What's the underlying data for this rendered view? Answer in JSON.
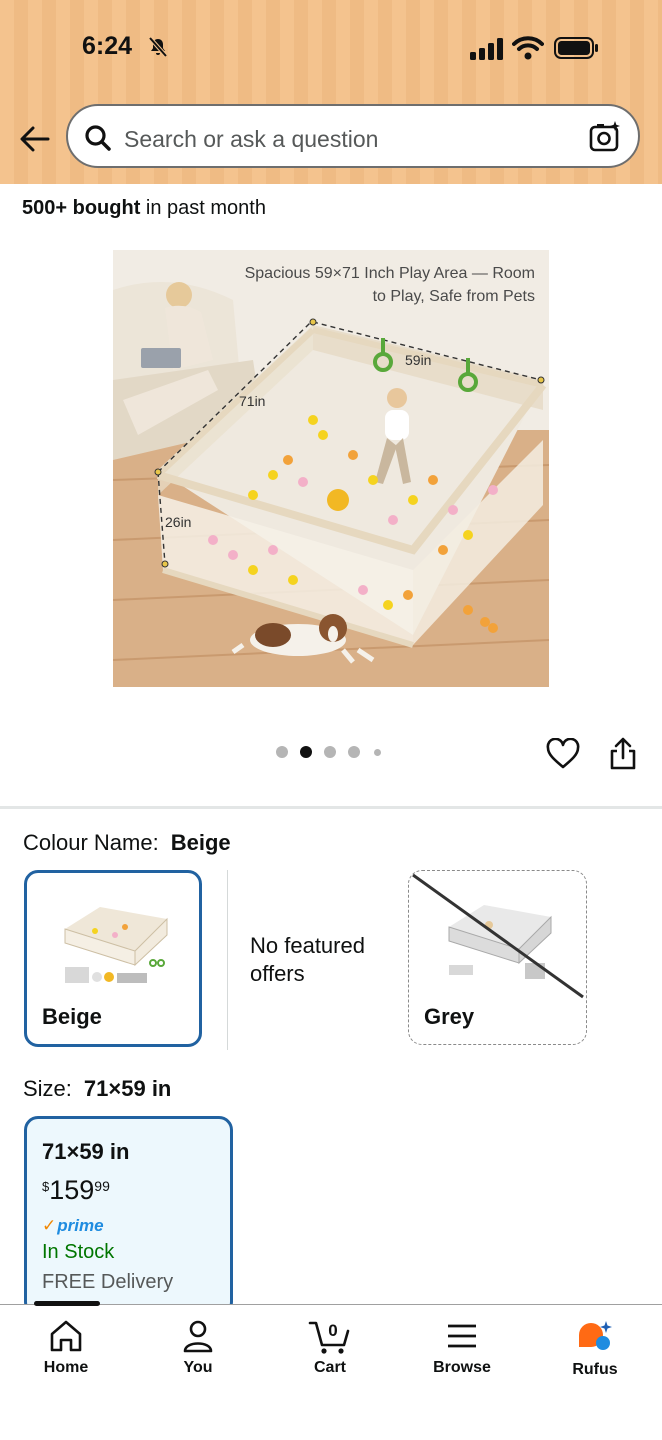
{
  "status_bar": {
    "time": "6:24"
  },
  "search": {
    "placeholder": "Search or ask a question"
  },
  "product": {
    "bought_bold": "500+ bought",
    "bought_rest": " in past month",
    "image_caption_line1": "Spacious 59×71 Inch Play Area — Room",
    "image_caption_line2": "to Play, Safe from Pets",
    "dim_width": "59in",
    "dim_depth": "71in",
    "dim_height": "26in",
    "image_count": 5,
    "active_image": 2
  },
  "colour": {
    "label": "Colour Name:",
    "selected": "Beige",
    "options": [
      {
        "name": "Beige"
      },
      {
        "name": "Grey"
      }
    ],
    "no_offers": "No featured offers"
  },
  "size": {
    "label": "Size:",
    "selected": "71×59 in",
    "card": {
      "title": "71×59 in",
      "currency": "$",
      "price_whole": "159",
      "price_cents": "99",
      "prime": "prime",
      "stock": "In Stock",
      "delivery": "FREE Delivery"
    }
  },
  "nav": {
    "items": [
      {
        "label": "Home",
        "icon": "home-icon"
      },
      {
        "label": "You",
        "icon": "person-icon"
      },
      {
        "label": "Cart",
        "icon": "cart-icon",
        "badge": "0"
      },
      {
        "label": "Browse",
        "icon": "menu-icon"
      },
      {
        "label": "Rufus",
        "icon": "rufus-icon"
      }
    ]
  },
  "colors": {
    "header_bg": "#f4c38e",
    "selected_border": "#2162a1",
    "in_stock": "#007600",
    "prime_blue": "#1f8ce0",
    "rufus_orange": "#ff6a14"
  }
}
